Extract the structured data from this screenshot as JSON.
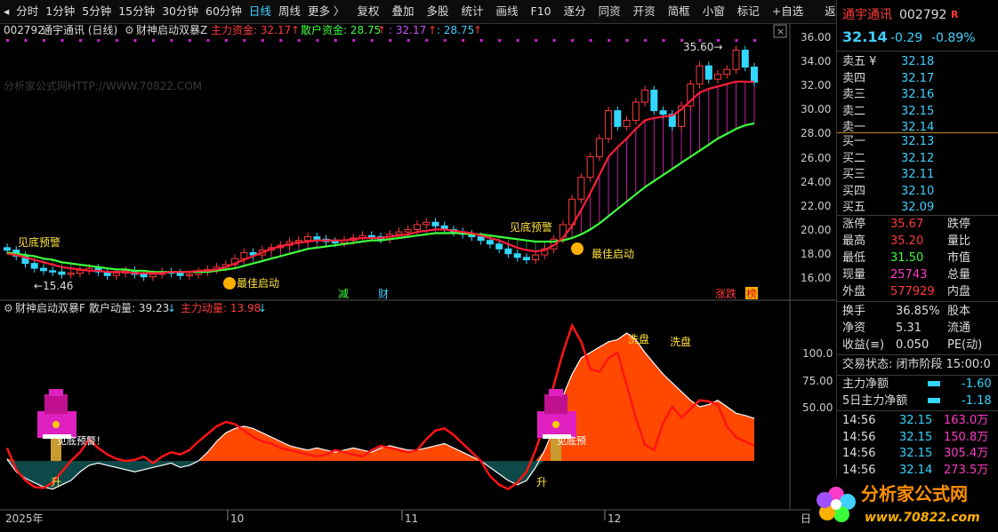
{
  "toolbar": {
    "periods": [
      "分时",
      "1分钟",
      "5分钟",
      "15分钟",
      "30分钟",
      "60分钟",
      "日线",
      "周线",
      "更多 〉"
    ],
    "active_period": "日线",
    "tools": [
      "复权",
      "叠加",
      "多股",
      "统计",
      "画线",
      "F10",
      "逐分",
      "同资",
      "开资",
      "简框",
      "小窗",
      "标记",
      "+自选",
      "返回"
    ]
  },
  "main_chart": {
    "code": "002792",
    "name": "通宇通讯 (日线)",
    "indicator": "财神启动双暴Z",
    "main_fund_label": "主力资金: 32.17",
    "retail_fund_label": "散户资金: 28.75",
    "extra1": ": 32.17",
    "extra2": ": 28.75",
    "watermark": "分析家公式网HTTP://WWW.70822.COM",
    "price_axis": [
      "36.00",
      "34.00",
      "32.00",
      "30.00",
      "28.00",
      "26.00",
      "24.00",
      "22.00",
      "20.00",
      "18.00",
      "16.00"
    ],
    "high_label": "35.60",
    "low_label": "15.46",
    "annotations": [
      "见底预警",
      "最佳启动",
      "见底预警",
      "最佳启动",
      "减",
      "财",
      "涨跌",
      "榜"
    ]
  },
  "sub_chart": {
    "indicator": "财神启动双暴F",
    "retail_label": "散户动量: 39.23",
    "main_label": "主力动量: 13.98",
    "axis": [
      "100.0",
      "75.00",
      "50.00"
    ],
    "annotations": [
      "见底预警！",
      "升",
      "见底预",
      "升",
      "洗盘",
      "洗盘"
    ]
  },
  "time_axis": [
    "2025年",
    "10",
    "11",
    "12",
    "日"
  ],
  "colors": {
    "up": "#ff3b3b",
    "down": "#33d6ff",
    "ma_red": "#ff1f3a",
    "ma_green": "#3cff3c",
    "bg": "#000000",
    "orange": "#ff5a00"
  },
  "chart_data": {
    "type": "candlestick",
    "x": [
      "2025-08-20",
      "2025-08-21",
      "2025-08-22",
      "2025-08-25",
      "2025-08-26",
      "2025-08-27",
      "2025-08-28",
      "2025-08-29",
      "2025-09-01",
      "2025-09-02",
      "2025-09-03",
      "2025-09-04",
      "2025-09-05",
      "2025-09-08",
      "2025-09-09",
      "2025-09-10",
      "2025-09-11",
      "2025-09-12",
      "2025-09-15",
      "2025-09-16",
      "2025-09-17",
      "2025-09-18",
      "2025-09-19",
      "2025-09-22",
      "2025-09-23",
      "2025-09-24",
      "2025-09-25",
      "2025-09-26",
      "2025-09-29",
      "2025-09-30",
      "2025-10-09",
      "2025-10-10",
      "2025-10-13",
      "2025-10-14",
      "2025-10-15",
      "2025-10-16",
      "2025-10-17",
      "2025-10-20",
      "2025-10-21",
      "2025-10-22",
      "2025-10-23",
      "2025-10-24",
      "2025-10-27",
      "2025-10-28",
      "2025-10-29",
      "2025-10-30",
      "2025-10-31",
      "2025-11-03",
      "2025-11-04",
      "2025-11-05",
      "2025-11-06",
      "2025-11-07",
      "2025-11-10",
      "2025-11-11",
      "2025-11-12",
      "2025-11-13",
      "2025-11-14",
      "2025-11-17",
      "2025-11-18",
      "2025-11-19",
      "2025-11-20",
      "2025-11-21",
      "2025-11-24",
      "2025-11-25",
      "2025-11-26",
      "2025-11-27",
      "2025-11-28",
      "2025-12-01",
      "2025-12-02",
      "2025-12-03",
      "2025-12-04",
      "2025-12-05",
      "2025-12-08",
      "2025-12-09",
      "2025-12-10",
      "2025-12-11",
      "2025-12-12",
      "2025-12-15",
      "2025-12-16",
      "2025-12-17",
      "2025-12-18",
      "2025-12-19",
      "2025-12-22"
    ],
    "close": [
      18.3,
      17.8,
      17.2,
      16.8,
      16.6,
      16.5,
      16.3,
      16.4,
      16.6,
      16.8,
      16.5,
      16.2,
      16.4,
      16.6,
      16.3,
      16.1,
      16.3,
      16.5,
      16.4,
      16.2,
      16.3,
      16.5,
      16.7,
      16.9,
      17.1,
      17.6,
      18.1,
      17.9,
      18.3,
      18.5,
      18.7,
      19.0,
      19.1,
      19.4,
      19.2,
      19.0,
      18.9,
      19.1,
      19.3,
      19.5,
      19.4,
      19.2,
      19.6,
      19.8,
      20.0,
      20.4,
      20.6,
      20.3,
      20.0,
      19.8,
      19.6,
      19.4,
      19.1,
      18.8,
      18.4,
      18.0,
      17.7,
      17.5,
      17.9,
      18.4,
      19.2,
      20.4,
      22.5,
      24.3,
      26.0,
      27.5,
      29.8,
      28.5,
      29.0,
      30.5,
      31.5,
      29.8,
      29.5,
      28.5,
      30.2,
      32.0,
      33.5,
      32.4,
      32.8,
      33.2,
      34.8,
      33.4,
      32.14
    ],
    "ma_red": [
      18.0,
      17.9,
      17.7,
      17.5,
      17.3,
      17.1,
      16.9,
      16.8,
      16.7,
      16.6,
      16.6,
      16.5,
      16.5,
      16.5,
      16.4,
      16.4,
      16.4,
      16.4,
      16.5,
      16.5,
      16.5,
      16.6,
      16.6,
      16.7,
      16.9,
      17.2,
      17.5,
      17.8,
      18.1,
      18.4,
      18.6,
      18.8,
      18.9,
      19.0,
      19.1,
      19.1,
      19.1,
      19.1,
      19.2,
      19.3,
      19.3,
      19.3,
      19.4,
      19.5,
      19.6,
      19.8,
      19.9,
      20.0,
      20.0,
      19.9,
      19.8,
      19.7,
      19.5,
      19.3,
      19.1,
      18.8,
      18.5,
      18.3,
      18.2,
      18.3,
      18.7,
      19.3,
      20.3,
      21.6,
      23.0,
      24.5,
      26.0,
      26.8,
      27.5,
      28.3,
      29.0,
      29.2,
      29.3,
      29.4,
      29.9,
      30.6,
      31.3,
      31.6,
      31.8,
      32.0,
      32.2,
      32.2,
      32.17
    ],
    "ma_green": [
      18.1,
      18.0,
      17.9,
      17.8,
      17.6,
      17.5,
      17.3,
      17.2,
      17.1,
      17.0,
      16.9,
      16.8,
      16.7,
      16.7,
      16.6,
      16.6,
      16.5,
      16.5,
      16.5,
      16.5,
      16.5,
      16.5,
      16.5,
      16.6,
      16.7,
      16.8,
      17.0,
      17.2,
      17.4,
      17.6,
      17.8,
      18.0,
      18.2,
      18.4,
      18.5,
      18.6,
      18.7,
      18.8,
      18.9,
      19.0,
      19.1,
      19.1,
      19.2,
      19.3,
      19.4,
      19.5,
      19.6,
      19.7,
      19.7,
      19.7,
      19.7,
      19.6,
      19.6,
      19.5,
      19.4,
      19.3,
      19.2,
      19.1,
      19.0,
      19.0,
      19.0,
      19.1,
      19.3,
      19.6,
      20.0,
      20.5,
      21.1,
      21.7,
      22.3,
      22.9,
      23.5,
      24.0,
      24.5,
      25.0,
      25.5,
      26.0,
      26.5,
      27.0,
      27.5,
      27.9,
      28.3,
      28.6,
      28.75
    ],
    "sub_main": [
      12,
      -8,
      -18,
      -24,
      -25,
      -20,
      -10,
      0,
      8,
      20,
      12,
      6,
      2,
      0,
      1,
      4,
      -2,
      4,
      8,
      6,
      10,
      18,
      25,
      32,
      36,
      34,
      28,
      22,
      18,
      16,
      12,
      10,
      8,
      6,
      4,
      6,
      10,
      8,
      6,
      4,
      10,
      14,
      12,
      10,
      8,
      10,
      20,
      28,
      30,
      24,
      16,
      8,
      0,
      -14,
      -22,
      -26,
      -20,
      -10,
      10,
      35,
      70,
      100,
      125,
      110,
      85,
      82,
      95,
      100,
      70,
      40,
      15,
      10,
      35,
      50,
      40,
      48,
      56,
      55,
      52,
      32,
      22,
      18,
      14
    ],
    "sub_retail": [
      2,
      -10,
      -16,
      -20,
      -24,
      -26,
      -22,
      -18,
      -10,
      -4,
      -2,
      -4,
      -6,
      -8,
      -10,
      -8,
      -6,
      -4,
      -2,
      -6,
      -4,
      0,
      8,
      18,
      26,
      30,
      32,
      30,
      26,
      22,
      18,
      14,
      12,
      10,
      12,
      10,
      8,
      10,
      12,
      10,
      8,
      12,
      14,
      12,
      10,
      10,
      12,
      14,
      16,
      12,
      8,
      4,
      0,
      -6,
      -12,
      -18,
      -22,
      -18,
      -6,
      10,
      30,
      60,
      80,
      95,
      100,
      105,
      110,
      112,
      118,
      112,
      100,
      90,
      80,
      72,
      64,
      56,
      50,
      52,
      56,
      50,
      44,
      42,
      39.23
    ]
  },
  "right_panel": {
    "name": "通宇通讯",
    "code": "002792",
    "badge": "R",
    "price": "32.14",
    "change": "-0.29",
    "change_pct": "-0.89%",
    "sell": [
      [
        "卖五 ¥",
        "32.18"
      ],
      [
        "卖四",
        "32.17"
      ],
      [
        "卖三",
        "32.16"
      ],
      [
        "卖二",
        "32.15"
      ],
      [
        "卖一",
        "32.14"
      ]
    ],
    "buy": [
      [
        "买一",
        "32.13"
      ],
      [
        "买二",
        "32.12"
      ],
      [
        "买三",
        "32.11"
      ],
      [
        "买四",
        "32.10"
      ],
      [
        "买五",
        "32.09"
      ]
    ],
    "stats": [
      [
        "涨停",
        "35.67",
        "跌停",
        ""
      ],
      [
        "最高",
        "35.20",
        "量比",
        ""
      ],
      [
        "最低",
        "31.50",
        "市值",
        ""
      ],
      [
        "现量",
        "25743",
        "总量",
        ""
      ],
      [
        "外盘",
        "577929",
        "内盘",
        ""
      ]
    ],
    "stats2": [
      [
        "换手",
        "36.85%",
        "股本"
      ],
      [
        "净资",
        "5.31",
        "流通"
      ],
      [
        "收益(≡)",
        "0.050",
        "PE(动)"
      ]
    ],
    "status": "交易状态: 闭市阶段 15:00:0",
    "flows": [
      [
        "主力净额",
        "-1.60"
      ],
      [
        "5日主力净额",
        "-1.18"
      ]
    ],
    "ticks": [
      [
        "14:56",
        "32.15",
        "163.0万"
      ],
      [
        "14:56",
        "32.15",
        "150.8万"
      ],
      [
        "14:56",
        "32.15",
        "305.4万"
      ],
      [
        "14:56",
        "32.14",
        "273.5万"
      ]
    ],
    "logo_text": "分析家公式网",
    "logo_url": "www.70822.com"
  }
}
